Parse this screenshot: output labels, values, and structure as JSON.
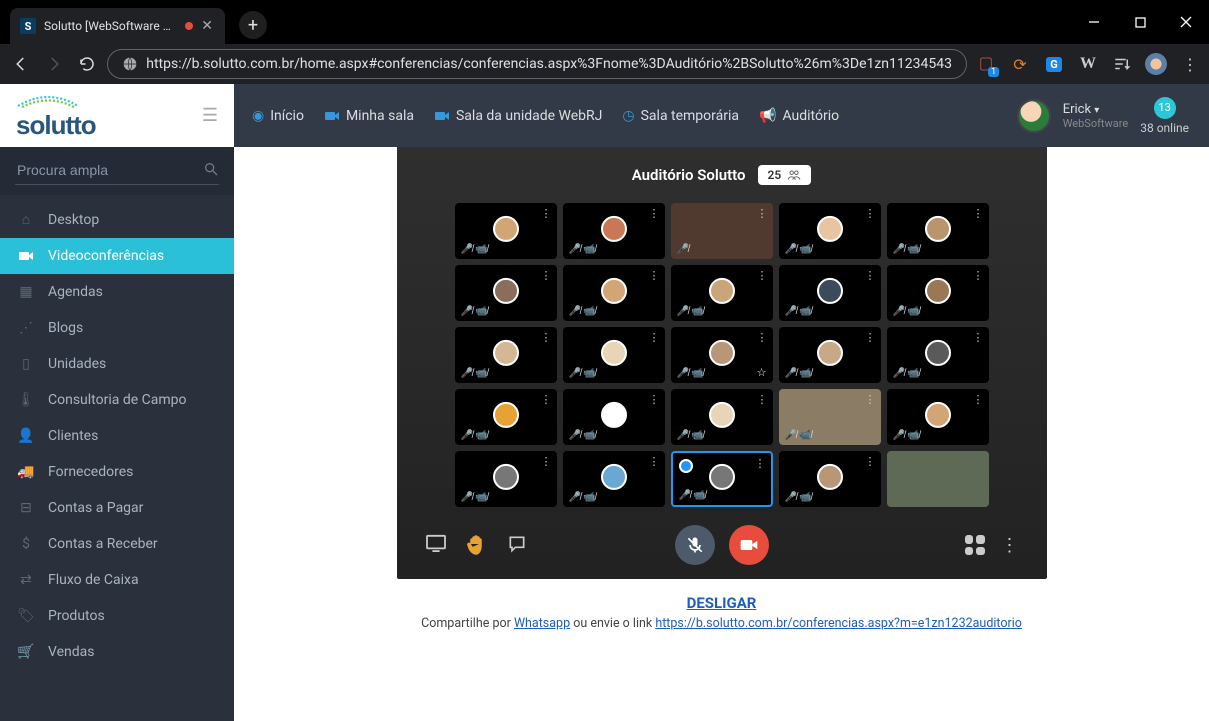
{
  "browser": {
    "tab_title": "Solutto [WebSoftware Solutt",
    "url": "https://b.solutto.com.br/home.aspx#conferencias/conferencias.aspx%3Fnome%3DAuditório%2BSolutto%26m%3De1zn11234543",
    "ext_badge": "1"
  },
  "top_nav": {
    "inicio": "Início",
    "minha_sala": "Minha sala",
    "sala_unidade": "Sala da unidade WebRJ",
    "sala_temp": "Sala temporária",
    "auditorio": "Auditório"
  },
  "user": {
    "name": "Erick",
    "company": "WebSoftware",
    "online_count": "13",
    "online_label": "38 online"
  },
  "search": {
    "placeholder": "Procura ampla"
  },
  "sidebar": {
    "items": [
      {
        "label": "Desktop"
      },
      {
        "label": "Videoconferências"
      },
      {
        "label": "Agendas"
      },
      {
        "label": "Blogs"
      },
      {
        "label": "Unidades"
      },
      {
        "label": "Consultoria de Campo"
      },
      {
        "label": "Clientes"
      },
      {
        "label": "Fornecedores"
      },
      {
        "label": "Contas a Pagar"
      },
      {
        "label": "Contas a Receber"
      },
      {
        "label": "Fluxo de Caixa"
      },
      {
        "label": "Produtos"
      },
      {
        "label": "Vendas"
      }
    ]
  },
  "conference": {
    "title": "Auditório Solutto",
    "count": "25"
  },
  "bottom": {
    "desligar": "DESLIGAR",
    "share_prefix": "Compartilhe por ",
    "whatsapp": "Whatsapp",
    "share_mid": " ou envie o link ",
    "share_url": "https://b.solutto.com.br/conferencias.aspx?m=e1zn1232auditorio"
  }
}
